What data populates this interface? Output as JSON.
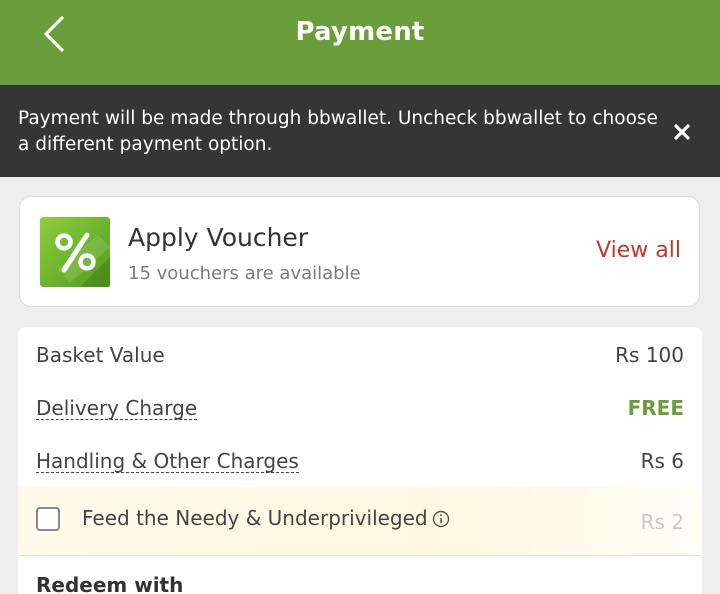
{
  "header": {
    "title": "Payment"
  },
  "banner": {
    "message": "Payment will be made through bbwallet. Uncheck bbwallet to choose a different payment option."
  },
  "voucher": {
    "title": "Apply Voucher",
    "subtitle": "15 vouchers are available",
    "view_all_label": "View all"
  },
  "summary": {
    "rows": [
      {
        "label": "Basket Value",
        "value": "Rs 100"
      },
      {
        "label": "Delivery Charge",
        "value": "FREE"
      },
      {
        "label": "Handling & Other Charges",
        "value": "Rs 6"
      }
    ],
    "feed": {
      "label": "Feed the Needy & Underprivileged",
      "value": "Rs 2",
      "checked": false
    },
    "redeem_label": "Redeem with"
  },
  "colors": {
    "brand_green": "#6a9e3a",
    "link_red": "#c0392b",
    "banner_bg": "#353535"
  },
  "icons": {
    "back": "chevron-left-icon",
    "close": "close-icon",
    "voucher": "percent-tag-icon",
    "info": "info-icon"
  }
}
